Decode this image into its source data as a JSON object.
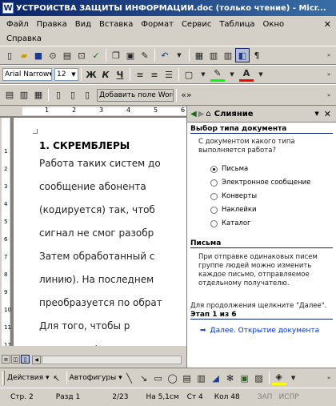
{
  "window": {
    "title": "УСТРОЙСТВА ЗАЩИТЫ ИНФОРМАЦИИ.doc (только чтение) - Micr...",
    "app_icon": "W"
  },
  "menu": {
    "row1": [
      "Файл",
      "Правка",
      "Вид",
      "Вставка",
      "Формат",
      "Сервис",
      "Таблица",
      "Окно"
    ],
    "row2": [
      "Справка"
    ],
    "close_doc": "✕"
  },
  "format_toolbar": {
    "font": "Arial Narrow",
    "size": "12",
    "bold": "Ж",
    "italic": "К",
    "underline": "Ч"
  },
  "mail_toolbar": {
    "insert_field": "Добавить поле Word"
  },
  "ruler": {
    "marks": [
      "1",
      "2",
      "3",
      "4",
      "5",
      "6"
    ],
    "vmarks": [
      "1",
      "2",
      "3",
      "4",
      "5",
      "6",
      "7",
      "8",
      "9",
      "10",
      "11",
      "12"
    ]
  },
  "document": {
    "heading": "1. СКРЕМБЛЕРЫ",
    "lines": [
      "Работа таких систем до",
      "сообщение абонента",
      "(кодируется) так, чтоб",
      "сигнал не смог разобр",
      "Затем обработанный с",
      "линию). На последнем",
      "преобразуется по обрат",
      "Для того, чтобы р",
      "криптографическим спо"
    ]
  },
  "task_pane": {
    "title": "Слияние",
    "section1": "Выбор типа документа",
    "question": "С документом какого типа выполняется работа?",
    "options": [
      {
        "label": "Письма",
        "selected": true
      },
      {
        "label": "Электронное сообщение",
        "selected": false
      },
      {
        "label": "Конверты",
        "selected": false
      },
      {
        "label": "Наклейки",
        "selected": false
      },
      {
        "label": "Каталог",
        "selected": false
      }
    ],
    "section2": "Письма",
    "desc": "При отправке одинаковых писем группе людей можно изменить каждое письмо, отправляемое отдельному получателю.",
    "continue_hint": "Для продолжения щелкните \"Далее\".",
    "step": "Этап 1 из 6",
    "next_link": "Далее. Открытие документа"
  },
  "drawing": {
    "actions": "Действия",
    "autoshapes": "Автофигуры"
  },
  "status": {
    "page": "Стр. 2",
    "section": "Разд 1",
    "pages": "2/23",
    "position": "На 5,1см",
    "line": "Ст 4",
    "column": "Кол 48",
    "rec": "ЗАП",
    "fix": "ИСПР"
  }
}
